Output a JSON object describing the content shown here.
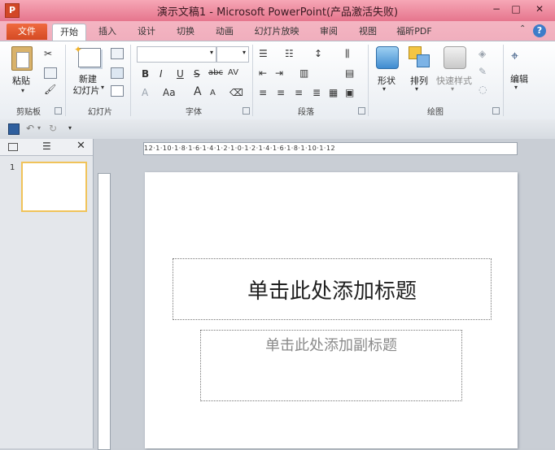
{
  "window": {
    "title": "演示文稿1 - Microsoft PowerPoint(产品激活失败)",
    "app_icon_letter": "P",
    "minimize": "−",
    "restore": "□",
    "close": "✕"
  },
  "tabs": [
    "文件",
    "开始",
    "插入",
    "设计",
    "切换",
    "动画",
    "幻灯片放映",
    "审阅",
    "视图",
    "福昕PDF"
  ],
  "help": "?",
  "collapse": "⌃",
  "ribbon": {
    "clipboard": {
      "paste": "粘贴",
      "label": "剪贴板"
    },
    "slides": {
      "new_line1": "新建",
      "new_line2": "幻灯片",
      "label": "幻灯片"
    },
    "font": {
      "label": "字体",
      "bold": "B",
      "italic": "I",
      "underline": "U",
      "strike": "S",
      "abc": "abc",
      "spacing": "AV",
      "case": "Aa",
      "grow": "A",
      "shrink": "A",
      "color": "A"
    },
    "paragraph": {
      "label": "段落"
    },
    "drawing": {
      "shapes": "形状",
      "arrange": "排列",
      "quick_styles": "快速样式",
      "label": "绘图"
    },
    "editing": {
      "edit": "编辑"
    }
  },
  "ruler": {
    "horizontal": "12·1·10·1·8·1·6·1·4·1·2·1·0·1·2·1·4·1·6·1·8·1·10·1·12"
  },
  "thumbnail": {
    "slide_number": "1",
    "close": "✕"
  },
  "slide": {
    "title_placeholder": "单击此处添加标题",
    "subtitle_placeholder": "单击此处添加副标题"
  }
}
